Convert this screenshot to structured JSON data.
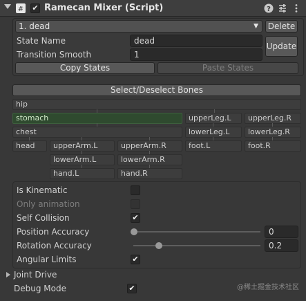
{
  "header": {
    "title": "Ramecan Mixer (Script)",
    "enabled": true,
    "icons": [
      "script-icon",
      "help-icon",
      "settings-icon",
      "more-icon"
    ]
  },
  "state": {
    "selected": "1. dead",
    "delete_label": "Delete",
    "update_label": "Update",
    "state_name_label": "State Name",
    "state_name_value": "dead",
    "transition_label": "Transition Smooth",
    "transition_value": "1",
    "copy_label": "Copy States",
    "paste_label": "Paste States"
  },
  "bones": {
    "select_label": "Select/Deselect Bones",
    "items": [
      "hip",
      "stomach",
      "upperLeg.L",
      "upperLeg.R",
      "chest",
      "lowerLeg.L",
      "lowerLeg.R",
      "head",
      "upperArm.L",
      "upperArm.R",
      "foot.L",
      "foot.R",
      "lowerArm.L",
      "lowerArm.R",
      "hand.L",
      "hand.R"
    ],
    "active": "stomach"
  },
  "props": {
    "is_kinematic_label": "Is Kinematic",
    "is_kinematic": false,
    "only_animation_label": "Only animation",
    "only_animation": false,
    "self_collision_label": "Self Collision",
    "self_collision": true,
    "position_accuracy_label": "Position Accuracy",
    "position_accuracy": "0",
    "rotation_accuracy_label": "Rotation Accuracy",
    "rotation_accuracy": "0.2",
    "angular_limits_label": "Angular Limits",
    "angular_limits": true
  },
  "joint_drive_label": "Joint Drive",
  "debug_mode_label": "Debug Mode",
  "debug_mode": true,
  "watermark": "@稀土掘金技术社区",
  "colors": {
    "active_bone": "#2f4a2f",
    "background": "#383838"
  }
}
